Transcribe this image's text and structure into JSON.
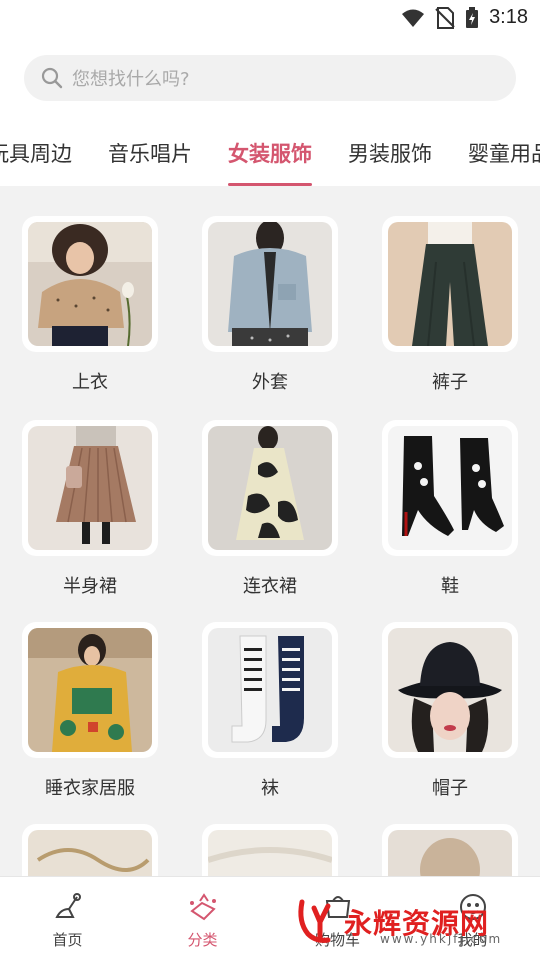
{
  "status_bar": {
    "time": "3:18"
  },
  "search": {
    "placeholder": "您想找什么吗?"
  },
  "tabs": [
    {
      "label": "玩具周边",
      "active": false
    },
    {
      "label": "音乐唱片",
      "active": false
    },
    {
      "label": "女装服饰",
      "active": true
    },
    {
      "label": "男装服饰",
      "active": false
    },
    {
      "label": "婴童用品",
      "active": false
    }
  ],
  "categories": [
    {
      "label": "上衣",
      "icon": "top-photo"
    },
    {
      "label": "外套",
      "icon": "coat-photo"
    },
    {
      "label": "裤子",
      "icon": "pants-photo"
    },
    {
      "label": "半身裙",
      "icon": "skirt-photo"
    },
    {
      "label": "连衣裙",
      "icon": "dress-photo"
    },
    {
      "label": "鞋",
      "icon": "shoes-photo"
    },
    {
      "label": "睡衣家居服",
      "icon": "pajamas-photo"
    },
    {
      "label": "袜",
      "icon": "socks-photo"
    },
    {
      "label": "帽子",
      "icon": "hat-photo"
    }
  ],
  "bottom_nav": [
    {
      "label": "首页",
      "icon": "home-icon",
      "active": false
    },
    {
      "label": "分类",
      "icon": "category-icon",
      "active": true
    },
    {
      "label": "购物车",
      "icon": "cart-icon",
      "active": false
    },
    {
      "label": "我的",
      "icon": "profile-icon",
      "active": false
    }
  ],
  "watermark": {
    "brand": "永辉资源网",
    "url": "www.yhkjfj.com"
  },
  "colors": {
    "accent": "#d4566f",
    "background": "#f2f2f2"
  }
}
